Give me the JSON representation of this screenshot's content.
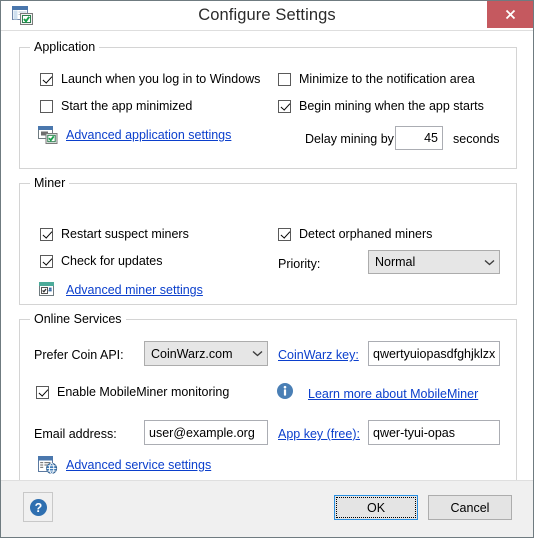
{
  "window": {
    "title": "Configure Settings",
    "icon": "window-settings-icon",
    "close_label": "close-icon",
    "accent_close_color": "#c5595f",
    "link_color": "#0b3fcc"
  },
  "groups": {
    "application": {
      "title": "Application",
      "checkboxes": [
        {
          "label": "Launch when you log in to Windows",
          "checked": true
        },
        {
          "label": "Start the app minimized",
          "checked": false
        },
        {
          "label": "Minimize to the notification area",
          "checked": false
        },
        {
          "label": "Begin mining when the app starts",
          "checked": true
        }
      ],
      "link": {
        "label": "Advanced application settings",
        "icon": "window-settings-icon"
      },
      "delay": {
        "label": "Delay mining by",
        "value": "45",
        "placeholder": "",
        "suffix": "seconds"
      }
    },
    "miner": {
      "title": "Miner",
      "checkboxes": [
        {
          "label": "Restart suspect miners",
          "checked": true
        },
        {
          "label": "Check for updates",
          "checked": true
        },
        {
          "label": "Detect orphaned miners",
          "checked": true
        }
      ],
      "priority": {
        "label": "Priority:",
        "value": "Normal",
        "options": [
          "Normal"
        ]
      },
      "link": {
        "label": "Advanced miner settings",
        "icon": "miner-settings-icon"
      }
    },
    "online": {
      "title": "Online Services",
      "coin_api": {
        "label": "Prefer Coin API:",
        "value": "CoinWarz.com",
        "options": [
          "CoinWarz.com"
        ]
      },
      "coinwarz_key": {
        "label": "CoinWarz key:",
        "value": "qwertyuiopasdfghjklzx",
        "placeholder": ""
      },
      "mobileminer_checkbox": {
        "label": "Enable MobileMiner monitoring",
        "checked": true
      },
      "mobileminer_info": {
        "icon": "info-icon",
        "link_label": "Learn more about MobileMiner"
      },
      "email": {
        "label": "Email address:",
        "value": "user@example.org",
        "placeholder": ""
      },
      "app_key": {
        "label": "App key (free):",
        "value": "qwer-tyui-opas",
        "placeholder": ""
      },
      "link": {
        "label": "Advanced service settings",
        "icon": "service-settings-icon"
      }
    }
  },
  "footer": {
    "help_label": "help-icon",
    "ok_label": "OK",
    "cancel_label": "Cancel"
  }
}
